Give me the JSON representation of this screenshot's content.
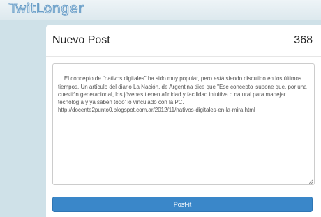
{
  "app": {
    "logo_text": "TwitLonger"
  },
  "composer": {
    "title": "Nuevo Post",
    "char_count": "368",
    "text": "El concepto de \"nativos digitales\" ha sido muy popular, pero está siendo discutido en los últimos tiempos. Un artículo del diario La Nación, de Argentina dice que \"Ese concepto 'supone que, por una cuestión generacional, los jóvenes tienen afinidad y facilidad intuitiva o natural para manejar tecnología y ya saben todo' lo vinculado con la PC.\nhttp://docente2punto0.blogspot.com.ar/2012/11/nativos-digitales-en-la-mira.html",
    "submit_label": "Post-it"
  },
  "colors": {
    "background": "#cfe1e8",
    "button": "#3a87c9"
  }
}
